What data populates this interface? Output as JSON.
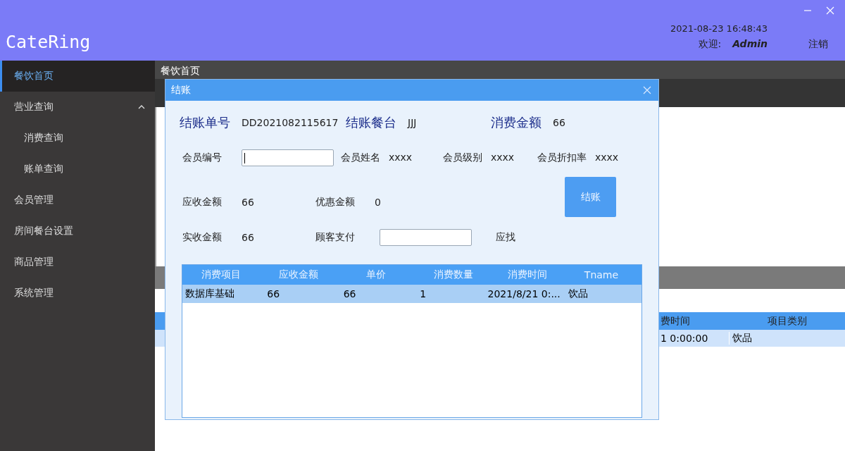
{
  "window": {
    "title": "CateRing",
    "datetime": "2021-08-23 16:48:43",
    "welcome_label": "欢迎:",
    "user": "Admin",
    "logout": "注销"
  },
  "sidebar": {
    "items": [
      {
        "label": "餐饮首页",
        "selected": true
      },
      {
        "label": "营业查询",
        "selected": false,
        "expanded": true,
        "children": [
          {
            "label": "消费查询",
            "selected": false
          },
          {
            "label": "账单查询",
            "selected": false
          }
        ]
      },
      {
        "label": "会员管理",
        "selected": false
      },
      {
        "label": "房间餐台设置",
        "selected": false
      },
      {
        "label": "商品管理",
        "selected": false
      },
      {
        "label": "系统管理",
        "selected": false
      }
    ]
  },
  "tabs": [
    {
      "label": "餐饮首页"
    }
  ],
  "background_table": {
    "columns": [
      "费时间",
      "项目类别"
    ],
    "rows": [
      [
        "1 0:00:00",
        "饮品"
      ]
    ]
  },
  "dialog": {
    "title": "结账",
    "summary": [
      {
        "label": "结账单号",
        "value": "DD2021082115617"
      },
      {
        "label": "结账餐台",
        "value": "JJJ"
      },
      {
        "label": "消费金额",
        "value": "66"
      }
    ],
    "member_no_label": "会员编号",
    "member_info": [
      {
        "label": "会员姓名",
        "value": "xxxx"
      },
      {
        "label": "会员级别",
        "value": "xxxx"
      },
      {
        "label": "会员折扣率",
        "value": "xxxx"
      }
    ],
    "receivable_label": "应收金额",
    "receivable": "66",
    "discount_label": "优惠金额",
    "discount": "0",
    "received_label": "实收金额",
    "received": "66",
    "payment_label": "顾客支付",
    "change_label": "应找",
    "checkout_button": "结账",
    "table": {
      "columns": [
        "消费项目",
        "应收金额",
        "单价",
        "消费数量",
        "消费时间",
        "Tname"
      ],
      "rows": [
        {
          "cells": [
            "数据库基础",
            "66",
            "66",
            "1",
            "2021/8/21 0:...",
            "饮品"
          ],
          "selected": true
        }
      ]
    }
  }
}
